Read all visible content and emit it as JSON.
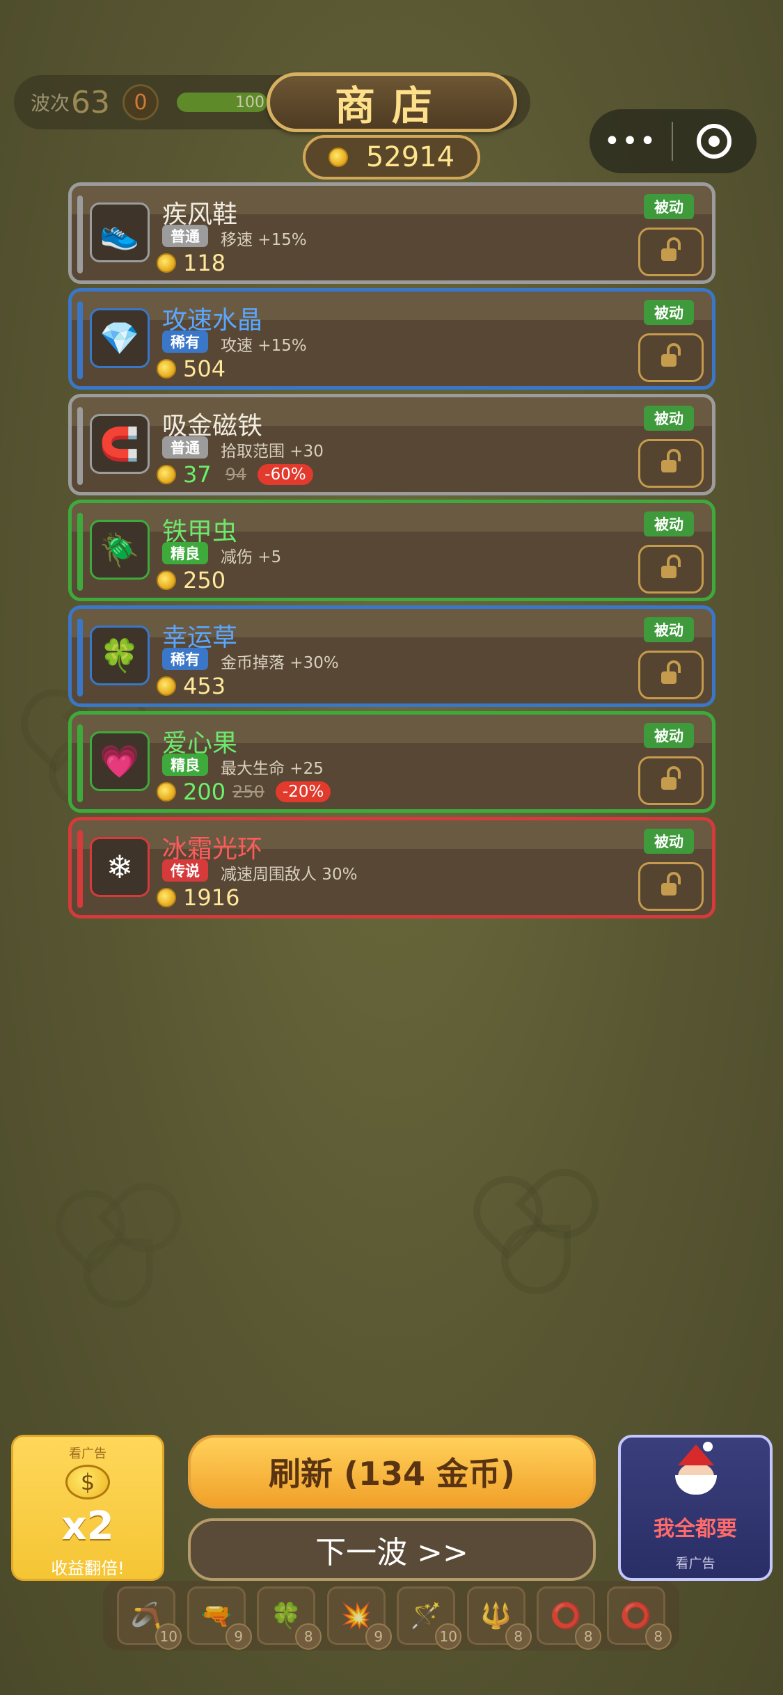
{
  "hud": {
    "wave_label": "波次",
    "wave_number": "63",
    "kills": "0",
    "hp_text": "100"
  },
  "shop": {
    "title": "商店",
    "coins": "52914"
  },
  "capsule": {
    "more_label": "•••"
  },
  "colors": {
    "common": "#9c9c9c",
    "rare": "#3a77c8",
    "elite": "#3faa3c",
    "legendary": "#d63a3a",
    "passive_badge": "#3e9a3a",
    "discount_badge": "#e23a2c"
  },
  "items": [
    {
      "name": "疾风鞋",
      "rarity": "普通",
      "rarity_key": "common",
      "desc": "移速 +15%",
      "price": "118",
      "tag": "被动",
      "icon": "red-sneakers-icon",
      "glyph": "👟"
    },
    {
      "name": "攻速水晶",
      "rarity": "稀有",
      "rarity_key": "rare",
      "desc": "攻速 +15%",
      "price": "504",
      "tag": "被动",
      "icon": "blue-diamond-icon",
      "glyph": "💎"
    },
    {
      "name": "吸金磁铁",
      "rarity": "普通",
      "rarity_key": "common",
      "desc": "拾取范围 +30",
      "price": "37",
      "old_price": "94",
      "discount": "-60%",
      "tag": "被动",
      "icon": "magnet-icon",
      "glyph": "🧲"
    },
    {
      "name": "铁甲虫",
      "rarity": "精良",
      "rarity_key": "elite",
      "desc": "减伤 +5",
      "price": "250",
      "tag": "被动",
      "icon": "armored-beetle-icon",
      "glyph": "🪲"
    },
    {
      "name": "幸运草",
      "rarity": "稀有",
      "rarity_key": "rare",
      "desc": "金币掉落 +30%",
      "price": "453",
      "tag": "被动",
      "icon": "lucky-clover-icon",
      "glyph": "🍀"
    },
    {
      "name": "爱心果",
      "rarity": "精良",
      "rarity_key": "elite",
      "desc": "最大生命 +25",
      "price": "200",
      "old_price": "250",
      "discount": "-20%",
      "tag": "被动",
      "icon": "heart-fruit-icon",
      "glyph": "💗"
    },
    {
      "name": "冰霜光环",
      "rarity": "传说",
      "rarity_key": "legendary",
      "desc": "减速周围敌人 30%",
      "price": "1916",
      "tag": "被动",
      "icon": "snowflake-icon",
      "glyph": "❄"
    }
  ],
  "ad_double": {
    "top": "看广告",
    "dollar": "$",
    "multiplier": "x2",
    "bottom": "收益翻倍!"
  },
  "refresh": {
    "label": "刷新 (134 金币)"
  },
  "next_wave": {
    "label": "下一波 >>"
  },
  "want_all": {
    "label": "我全都要",
    "sub": "看广告"
  },
  "equipment": [
    {
      "icon": "slingshot-icon",
      "glyph": "🪃",
      "level": "10"
    },
    {
      "icon": "blaster-gun-icon",
      "glyph": "🔫",
      "level": "9"
    },
    {
      "icon": "clover-icon",
      "glyph": "🍀",
      "level": "8"
    },
    {
      "icon": "cannon-icon",
      "glyph": "💥",
      "level": "9"
    },
    {
      "icon": "magic-wand-icon",
      "glyph": "🪄",
      "level": "10"
    },
    {
      "icon": "ice-staff-icon",
      "glyph": "🔱",
      "level": "8"
    },
    {
      "icon": "ring-aura-icon",
      "glyph": "⭕",
      "level": "8"
    },
    {
      "icon": "ring-aura-icon",
      "glyph": "⭕",
      "level": "8"
    }
  ]
}
